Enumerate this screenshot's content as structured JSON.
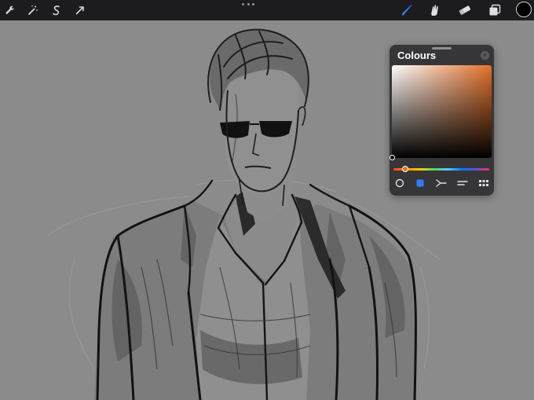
{
  "toolbar": {
    "left_tools": [
      {
        "name": "wrench-icon"
      },
      {
        "name": "magic-wand-icon"
      },
      {
        "name": "selection-icon"
      },
      {
        "name": "transform-arrow-icon"
      }
    ],
    "right_tools": [
      {
        "name": "brush-icon",
        "active": true
      },
      {
        "name": "smudge-icon"
      },
      {
        "name": "eraser-icon"
      },
      {
        "name": "layers-icon"
      }
    ],
    "current_colour": "#000000",
    "accent": "#2f7cf6"
  },
  "colours_panel": {
    "title": "Colours",
    "close_icon": "close-icon",
    "hue_color": "#e2702a",
    "modes": [
      {
        "name": "disc-mode-icon"
      },
      {
        "name": "classic-mode-icon",
        "active": true
      },
      {
        "name": "harmony-mode-icon"
      },
      {
        "name": "value-mode-icon"
      },
      {
        "name": "palettes-mode-icon"
      }
    ]
  },
  "canvas": {
    "background": "#8b8b8b",
    "subject": "sketch-of-man-in-sunglasses-and-jacket"
  }
}
